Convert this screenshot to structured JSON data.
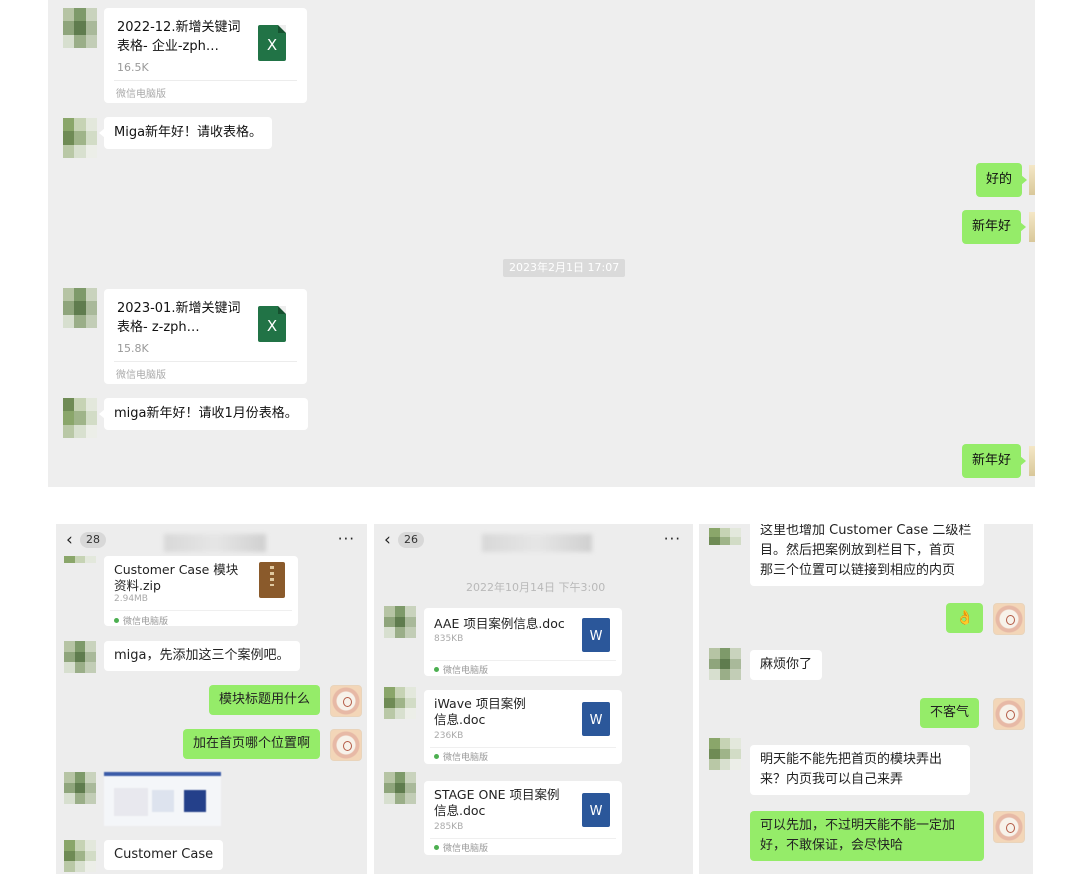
{
  "top_chat": {
    "messages": [
      {
        "file_name": "2022-12.新增关键词表格-       ‌企业-zph…",
        "file_line1": "2022-12.新增关键词",
        "file_line2": "表格-       企业-zph…",
        "file_size": "16.5K",
        "source": "微信电脑版"
      },
      {
        "text": "Miga新年好！请收表格。"
      },
      {
        "text": "好的"
      },
      {
        "text": "新年好"
      },
      {
        "timestamp": "2023年2月1日 17:07"
      },
      {
        "file_line1": "2023-01.新增关键词",
        "file_line2": "表格-           z-zph…",
        "file_size": "15.8K",
        "source": "微信电脑版"
      },
      {
        "text": "miga新年好！请收1月份表格。"
      },
      {
        "text": "新年好"
      }
    ],
    "xls_icon_letter": "X"
  },
  "phone1": {
    "back_count": "28",
    "zip_file": {
      "line1": "Customer Case 模块",
      "line2": "资料.zip",
      "size": "2.94MB",
      "source": "微信电脑版"
    },
    "msg1": "miga，先添加这三个案例吧。",
    "msg2": "模块标题用什么",
    "msg3": "加在首页哪个位置啊",
    "msg4": "Customer Case",
    "more": "···"
  },
  "phone2": {
    "back_count": "26",
    "timestamp": "2022年10月14日 下午3:00",
    "files": [
      {
        "line1": "AAE 项目案例信息.doc",
        "line2": "",
        "size": "835KB",
        "source": "微信电脑版"
      },
      {
        "line1": "iWave 项目案例",
        "line2": "信息.doc",
        "size": "236KB",
        "source": "微信电脑版"
      },
      {
        "line1": "STAGE ONE 项目案例",
        "line2": "信息.doc",
        "size": "285KB",
        "source": "微信电脑版"
      }
    ],
    "doc_icon_letter": "W",
    "more": "···"
  },
  "phone3": {
    "msg_top_line1": "这里也增加 Customer Case 二级栏",
    "msg_top_line2": "目。然后把案例放到栏目下，首页",
    "msg_top_line3": "那三个位置可以链接到相应的内页",
    "emoji": "👌",
    "msg_thanks": "麻烦你了",
    "msg_welcome": "不客气",
    "msg_q_line1": "明天能不能先把首页的模块弄出",
    "msg_q_line2": "来？内页我可以自己来弄",
    "msg_a_line1": "可以先加，不过明天能不能一定加",
    "msg_a_line2": "好，不敢保证，会尽快哈"
  },
  "colors": {
    "bubble_green": "#95ec69",
    "chat_bg": "#eeeeee",
    "excel_green": "#217346",
    "word_blue": "#2b579a"
  }
}
